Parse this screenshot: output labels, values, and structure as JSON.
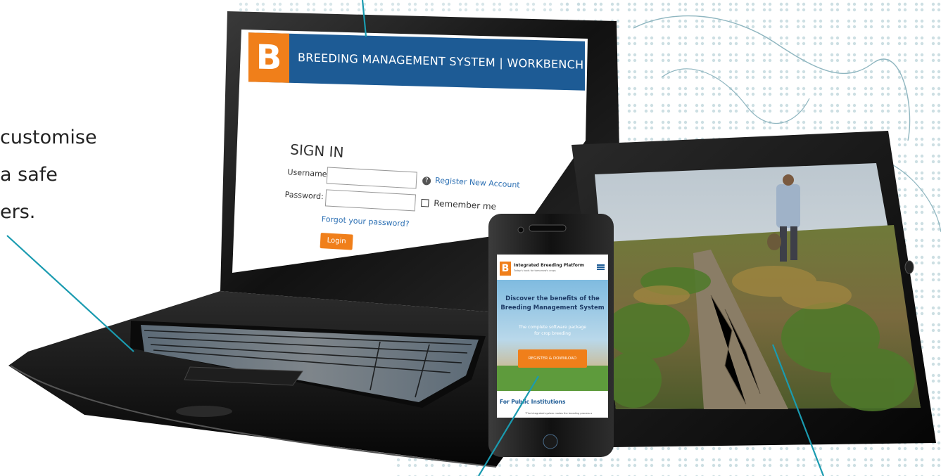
{
  "intro_text": {
    "line1": "customise",
    "line2": "a safe",
    "line3": "ers."
  },
  "laptop": {
    "app_title": "BREEDING MANAGEMENT SYSTEM | WORKBENCH",
    "logo_letter": "B",
    "sign_in_heading": "SIGN IN",
    "username_label": "Username:",
    "password_label": "Password:",
    "help_icon": "?",
    "register_link": "Register New Account",
    "remember_label": "Remember me",
    "forgot_link": "Forgot your password?",
    "login_button": "Login",
    "brand_blue": "#1d5b95",
    "brand_orange": "#f07f1a"
  },
  "phone": {
    "site_title": "Integrated Breeding Platform",
    "site_tagline": "Today's tools for tomorrow's crops",
    "logo_letter": "B",
    "menu_icon": "hamburger-menu-icon",
    "hero_heading_1": "Discover the benefits of the",
    "hero_heading_2": "Breeding Management System",
    "hero_sub_1": "The complete software package",
    "hero_sub_2": "for crop breeding",
    "cta_button": "REGISTER & DOWNLOAD",
    "section_heading": "For Public Institutions",
    "quote_text": "\"The integrated system makes the breeding process a"
  },
  "tablet": {
    "photo_subject": "farmer-in-bean-field"
  },
  "colors": {
    "callout_line": "#1a9bb0",
    "map_dots": "#a9c7cf"
  }
}
